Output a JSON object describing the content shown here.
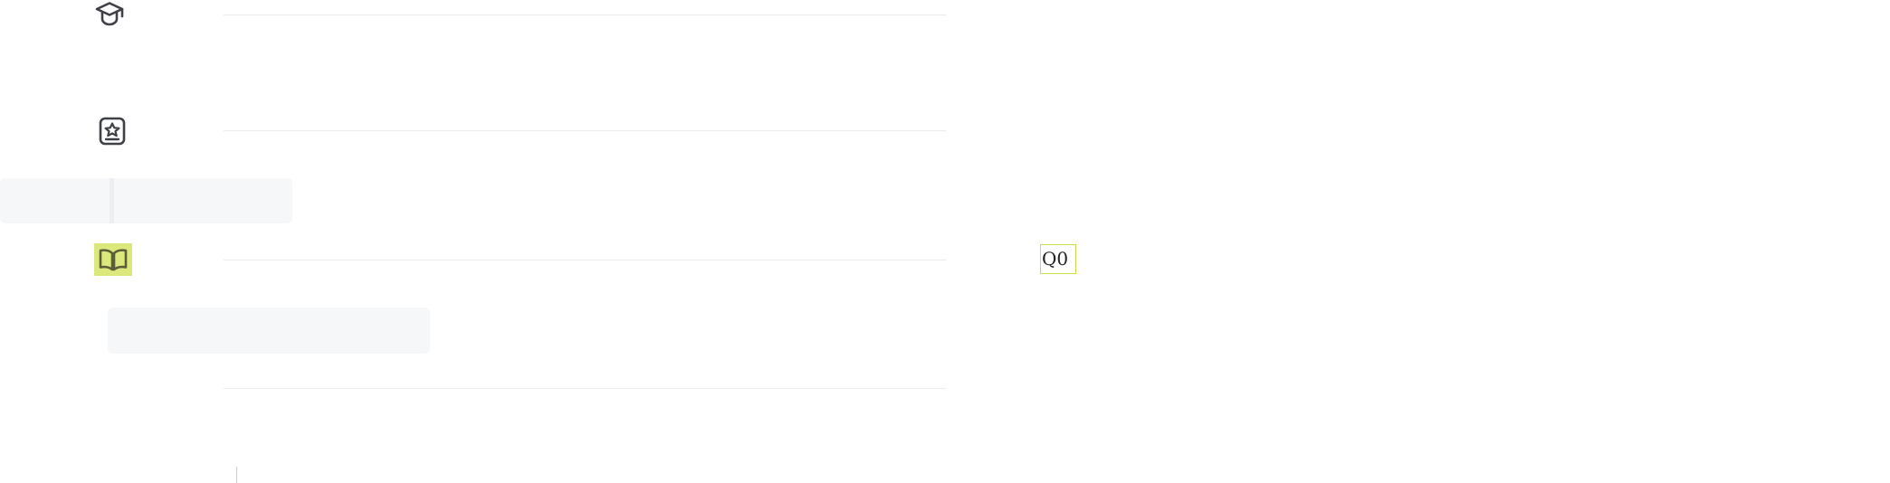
{
  "icons": {
    "item_1": "graduation-cap-icon",
    "item_2": "badge-star-icon",
    "item_3": "open-book-icon"
  },
  "colors": {
    "icon_stroke": "#3e4046",
    "highlight": "#dde87c",
    "badge_border": "#c9dc4a",
    "divider": "#ececee",
    "skeleton": "#f6f7f9"
  },
  "badge": {
    "text": "Q0"
  }
}
